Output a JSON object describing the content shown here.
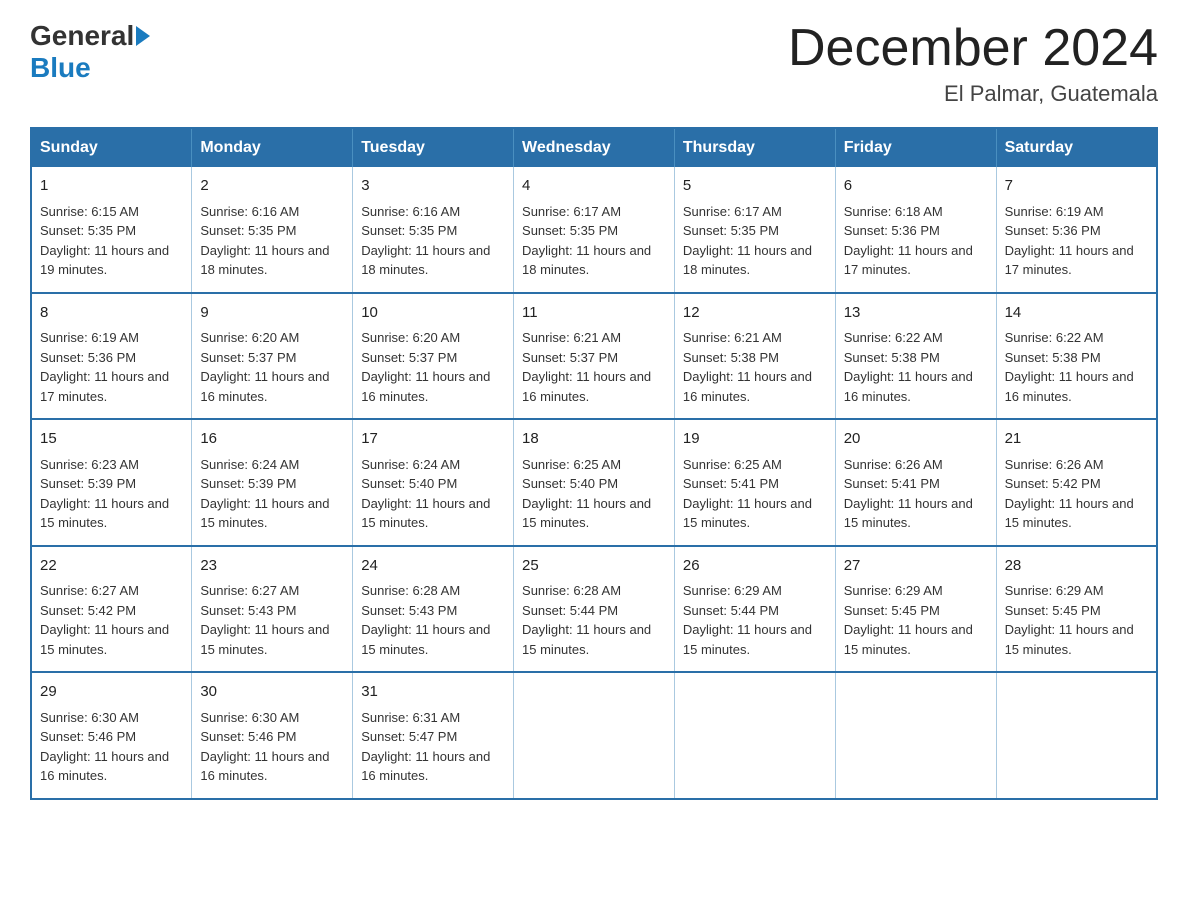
{
  "header": {
    "logo_general": "General",
    "logo_blue": "Blue",
    "month_title": "December 2024",
    "location": "El Palmar, Guatemala"
  },
  "calendar": {
    "days_of_week": [
      "Sunday",
      "Monday",
      "Tuesday",
      "Wednesday",
      "Thursday",
      "Friday",
      "Saturday"
    ],
    "weeks": [
      [
        {
          "day": "1",
          "sunrise": "6:15 AM",
          "sunset": "5:35 PM",
          "daylight": "11 hours and 19 minutes."
        },
        {
          "day": "2",
          "sunrise": "6:16 AM",
          "sunset": "5:35 PM",
          "daylight": "11 hours and 18 minutes."
        },
        {
          "day": "3",
          "sunrise": "6:16 AM",
          "sunset": "5:35 PM",
          "daylight": "11 hours and 18 minutes."
        },
        {
          "day": "4",
          "sunrise": "6:17 AM",
          "sunset": "5:35 PM",
          "daylight": "11 hours and 18 minutes."
        },
        {
          "day": "5",
          "sunrise": "6:17 AM",
          "sunset": "5:35 PM",
          "daylight": "11 hours and 18 minutes."
        },
        {
          "day": "6",
          "sunrise": "6:18 AM",
          "sunset": "5:36 PM",
          "daylight": "11 hours and 17 minutes."
        },
        {
          "day": "7",
          "sunrise": "6:19 AM",
          "sunset": "5:36 PM",
          "daylight": "11 hours and 17 minutes."
        }
      ],
      [
        {
          "day": "8",
          "sunrise": "6:19 AM",
          "sunset": "5:36 PM",
          "daylight": "11 hours and 17 minutes."
        },
        {
          "day": "9",
          "sunrise": "6:20 AM",
          "sunset": "5:37 PM",
          "daylight": "11 hours and 16 minutes."
        },
        {
          "day": "10",
          "sunrise": "6:20 AM",
          "sunset": "5:37 PM",
          "daylight": "11 hours and 16 minutes."
        },
        {
          "day": "11",
          "sunrise": "6:21 AM",
          "sunset": "5:37 PM",
          "daylight": "11 hours and 16 minutes."
        },
        {
          "day": "12",
          "sunrise": "6:21 AM",
          "sunset": "5:38 PM",
          "daylight": "11 hours and 16 minutes."
        },
        {
          "day": "13",
          "sunrise": "6:22 AM",
          "sunset": "5:38 PM",
          "daylight": "11 hours and 16 minutes."
        },
        {
          "day": "14",
          "sunrise": "6:22 AM",
          "sunset": "5:38 PM",
          "daylight": "11 hours and 16 minutes."
        }
      ],
      [
        {
          "day": "15",
          "sunrise": "6:23 AM",
          "sunset": "5:39 PM",
          "daylight": "11 hours and 15 minutes."
        },
        {
          "day": "16",
          "sunrise": "6:24 AM",
          "sunset": "5:39 PM",
          "daylight": "11 hours and 15 minutes."
        },
        {
          "day": "17",
          "sunrise": "6:24 AM",
          "sunset": "5:40 PM",
          "daylight": "11 hours and 15 minutes."
        },
        {
          "day": "18",
          "sunrise": "6:25 AM",
          "sunset": "5:40 PM",
          "daylight": "11 hours and 15 minutes."
        },
        {
          "day": "19",
          "sunrise": "6:25 AM",
          "sunset": "5:41 PM",
          "daylight": "11 hours and 15 minutes."
        },
        {
          "day": "20",
          "sunrise": "6:26 AM",
          "sunset": "5:41 PM",
          "daylight": "11 hours and 15 minutes."
        },
        {
          "day": "21",
          "sunrise": "6:26 AM",
          "sunset": "5:42 PM",
          "daylight": "11 hours and 15 minutes."
        }
      ],
      [
        {
          "day": "22",
          "sunrise": "6:27 AM",
          "sunset": "5:42 PM",
          "daylight": "11 hours and 15 minutes."
        },
        {
          "day": "23",
          "sunrise": "6:27 AM",
          "sunset": "5:43 PM",
          "daylight": "11 hours and 15 minutes."
        },
        {
          "day": "24",
          "sunrise": "6:28 AM",
          "sunset": "5:43 PM",
          "daylight": "11 hours and 15 minutes."
        },
        {
          "day": "25",
          "sunrise": "6:28 AM",
          "sunset": "5:44 PM",
          "daylight": "11 hours and 15 minutes."
        },
        {
          "day": "26",
          "sunrise": "6:29 AM",
          "sunset": "5:44 PM",
          "daylight": "11 hours and 15 minutes."
        },
        {
          "day": "27",
          "sunrise": "6:29 AM",
          "sunset": "5:45 PM",
          "daylight": "11 hours and 15 minutes."
        },
        {
          "day": "28",
          "sunrise": "6:29 AM",
          "sunset": "5:45 PM",
          "daylight": "11 hours and 15 minutes."
        }
      ],
      [
        {
          "day": "29",
          "sunrise": "6:30 AM",
          "sunset": "5:46 PM",
          "daylight": "11 hours and 16 minutes."
        },
        {
          "day": "30",
          "sunrise": "6:30 AM",
          "sunset": "5:46 PM",
          "daylight": "11 hours and 16 minutes."
        },
        {
          "day": "31",
          "sunrise": "6:31 AM",
          "sunset": "5:47 PM",
          "daylight": "11 hours and 16 minutes."
        },
        null,
        null,
        null,
        null
      ]
    ]
  }
}
